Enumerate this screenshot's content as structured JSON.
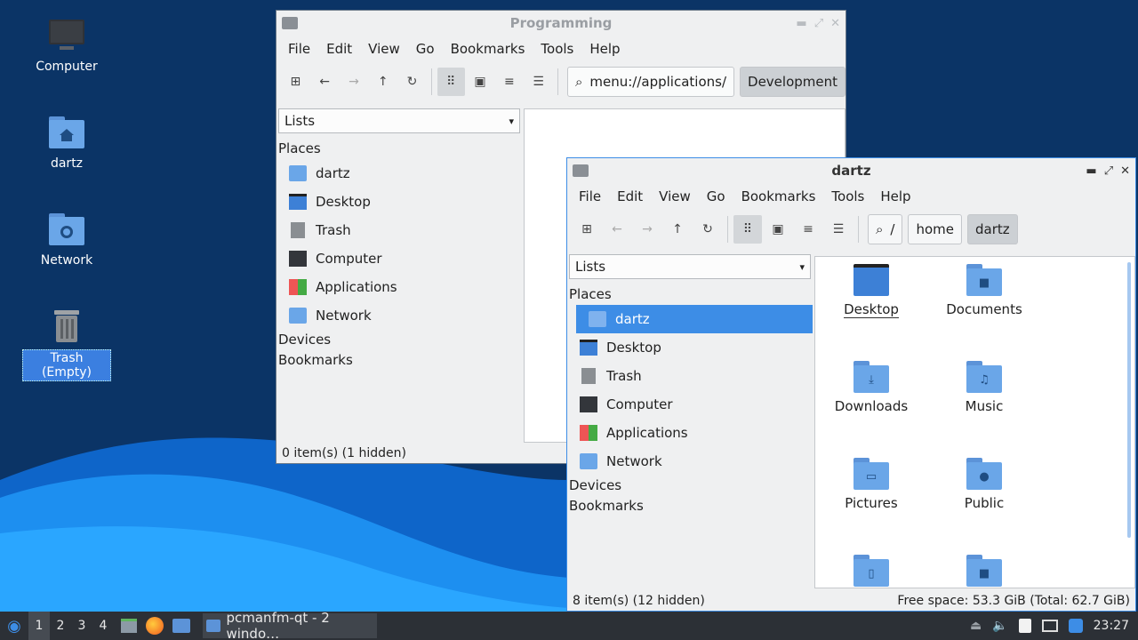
{
  "desktop": {
    "icons": [
      {
        "label": "Computer"
      },
      {
        "label": "dartz"
      },
      {
        "label": "Network"
      },
      {
        "label": "Trash (Empty)"
      }
    ]
  },
  "programming_window": {
    "title": "Programming",
    "menu": [
      "File",
      "Edit",
      "View",
      "Go",
      "Bookmarks",
      "Tools",
      "Help"
    ],
    "path": "menu://applications/",
    "crumb": "Development",
    "side_combo": "Lists",
    "places_header": "Places",
    "places": [
      "dartz",
      "Desktop",
      "Trash",
      "Computer",
      "Applications",
      "Network"
    ],
    "devices": "Devices",
    "bookmarks": "Bookmarks",
    "status": "0 item(s) (1 hidden)"
  },
  "dartz_window": {
    "title": "dartz",
    "menu": [
      "File",
      "Edit",
      "View",
      "Go",
      "Bookmarks",
      "Tools",
      "Help"
    ],
    "crumbs": [
      "/",
      "home",
      "dartz"
    ],
    "side_combo": "Lists",
    "places_header": "Places",
    "places": [
      "dartz",
      "Desktop",
      "Trash",
      "Computer",
      "Applications",
      "Network"
    ],
    "devices": "Devices",
    "bookmarks": "Bookmarks",
    "files": [
      "Desktop",
      "Documents",
      "Downloads",
      "Music",
      "Pictures",
      "Public"
    ],
    "status_left": "8 item(s) (12 hidden)",
    "status_right": "Free space: 53.3 GiB (Total: 62.7 GiB)"
  },
  "taskbar": {
    "workspaces": [
      "1",
      "2",
      "3",
      "4"
    ],
    "task_label": "pcmanfm-qt - 2 windo…",
    "clock": "23:27"
  },
  "colors": {
    "accent": "#3d8de6",
    "folder": "#6aa6e8",
    "panel": "#2c3036"
  }
}
